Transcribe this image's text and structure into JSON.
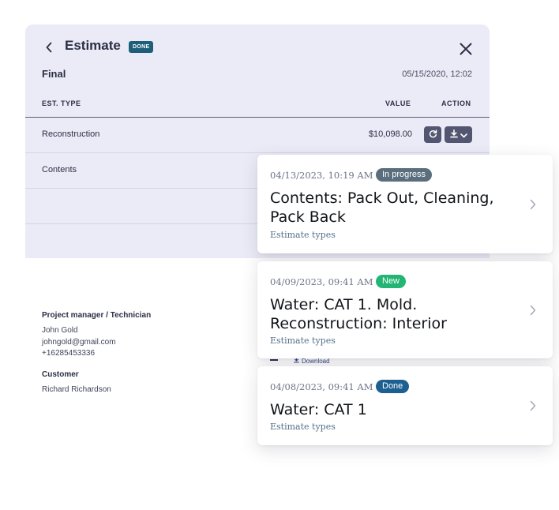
{
  "estimate_panel": {
    "title": "Estimate",
    "status_badge": "DONE",
    "final_label": "Final",
    "final_datetime": "05/15/2020, 12:02",
    "columns": {
      "type": "EST. TYPE",
      "value": "VALUE",
      "action": "ACTION"
    },
    "rows": [
      {
        "type": "Reconstruction",
        "value": "$10,098.00"
      },
      {
        "type": "Contents",
        "value": ""
      }
    ],
    "colors": {
      "panel_bg": "#ebebf7",
      "badge_bg": "#1d5f7a",
      "action_button": "#525670"
    }
  },
  "project": {
    "pm_heading": "Project manager / Technician",
    "pm_name": "John Gold",
    "pm_email": "johngold@gmail.com",
    "pm_phone": "+16285453336",
    "customer_heading": "Customer",
    "customer_name": "Richard Richardson",
    "download_label": "Download"
  },
  "cards": [
    {
      "datetime": "04/13/2023, 10:19 AM",
      "status": "In progress",
      "status_color": "#5a6e7e",
      "title": "Contents: Pack Out, Cleaning, Pack Back",
      "subtitle": "Estimate types"
    },
    {
      "datetime": "04/09/2023, 09:41 AM",
      "status": "New",
      "status_color": "#22b573",
      "title": "Water: CAT 1. Mold. Reconstruction: Interior",
      "subtitle": "Estimate types"
    },
    {
      "datetime": "04/08/2023, 09:41 AM",
      "status": "Done",
      "status_color": "#1d5f91",
      "title": "Water: CAT 1",
      "subtitle": "Estimate types"
    }
  ],
  "icons": [
    "chevron-left-icon",
    "close-icon",
    "refresh-icon",
    "download-icon",
    "chevron-down-icon",
    "chevron-right-icon"
  ]
}
